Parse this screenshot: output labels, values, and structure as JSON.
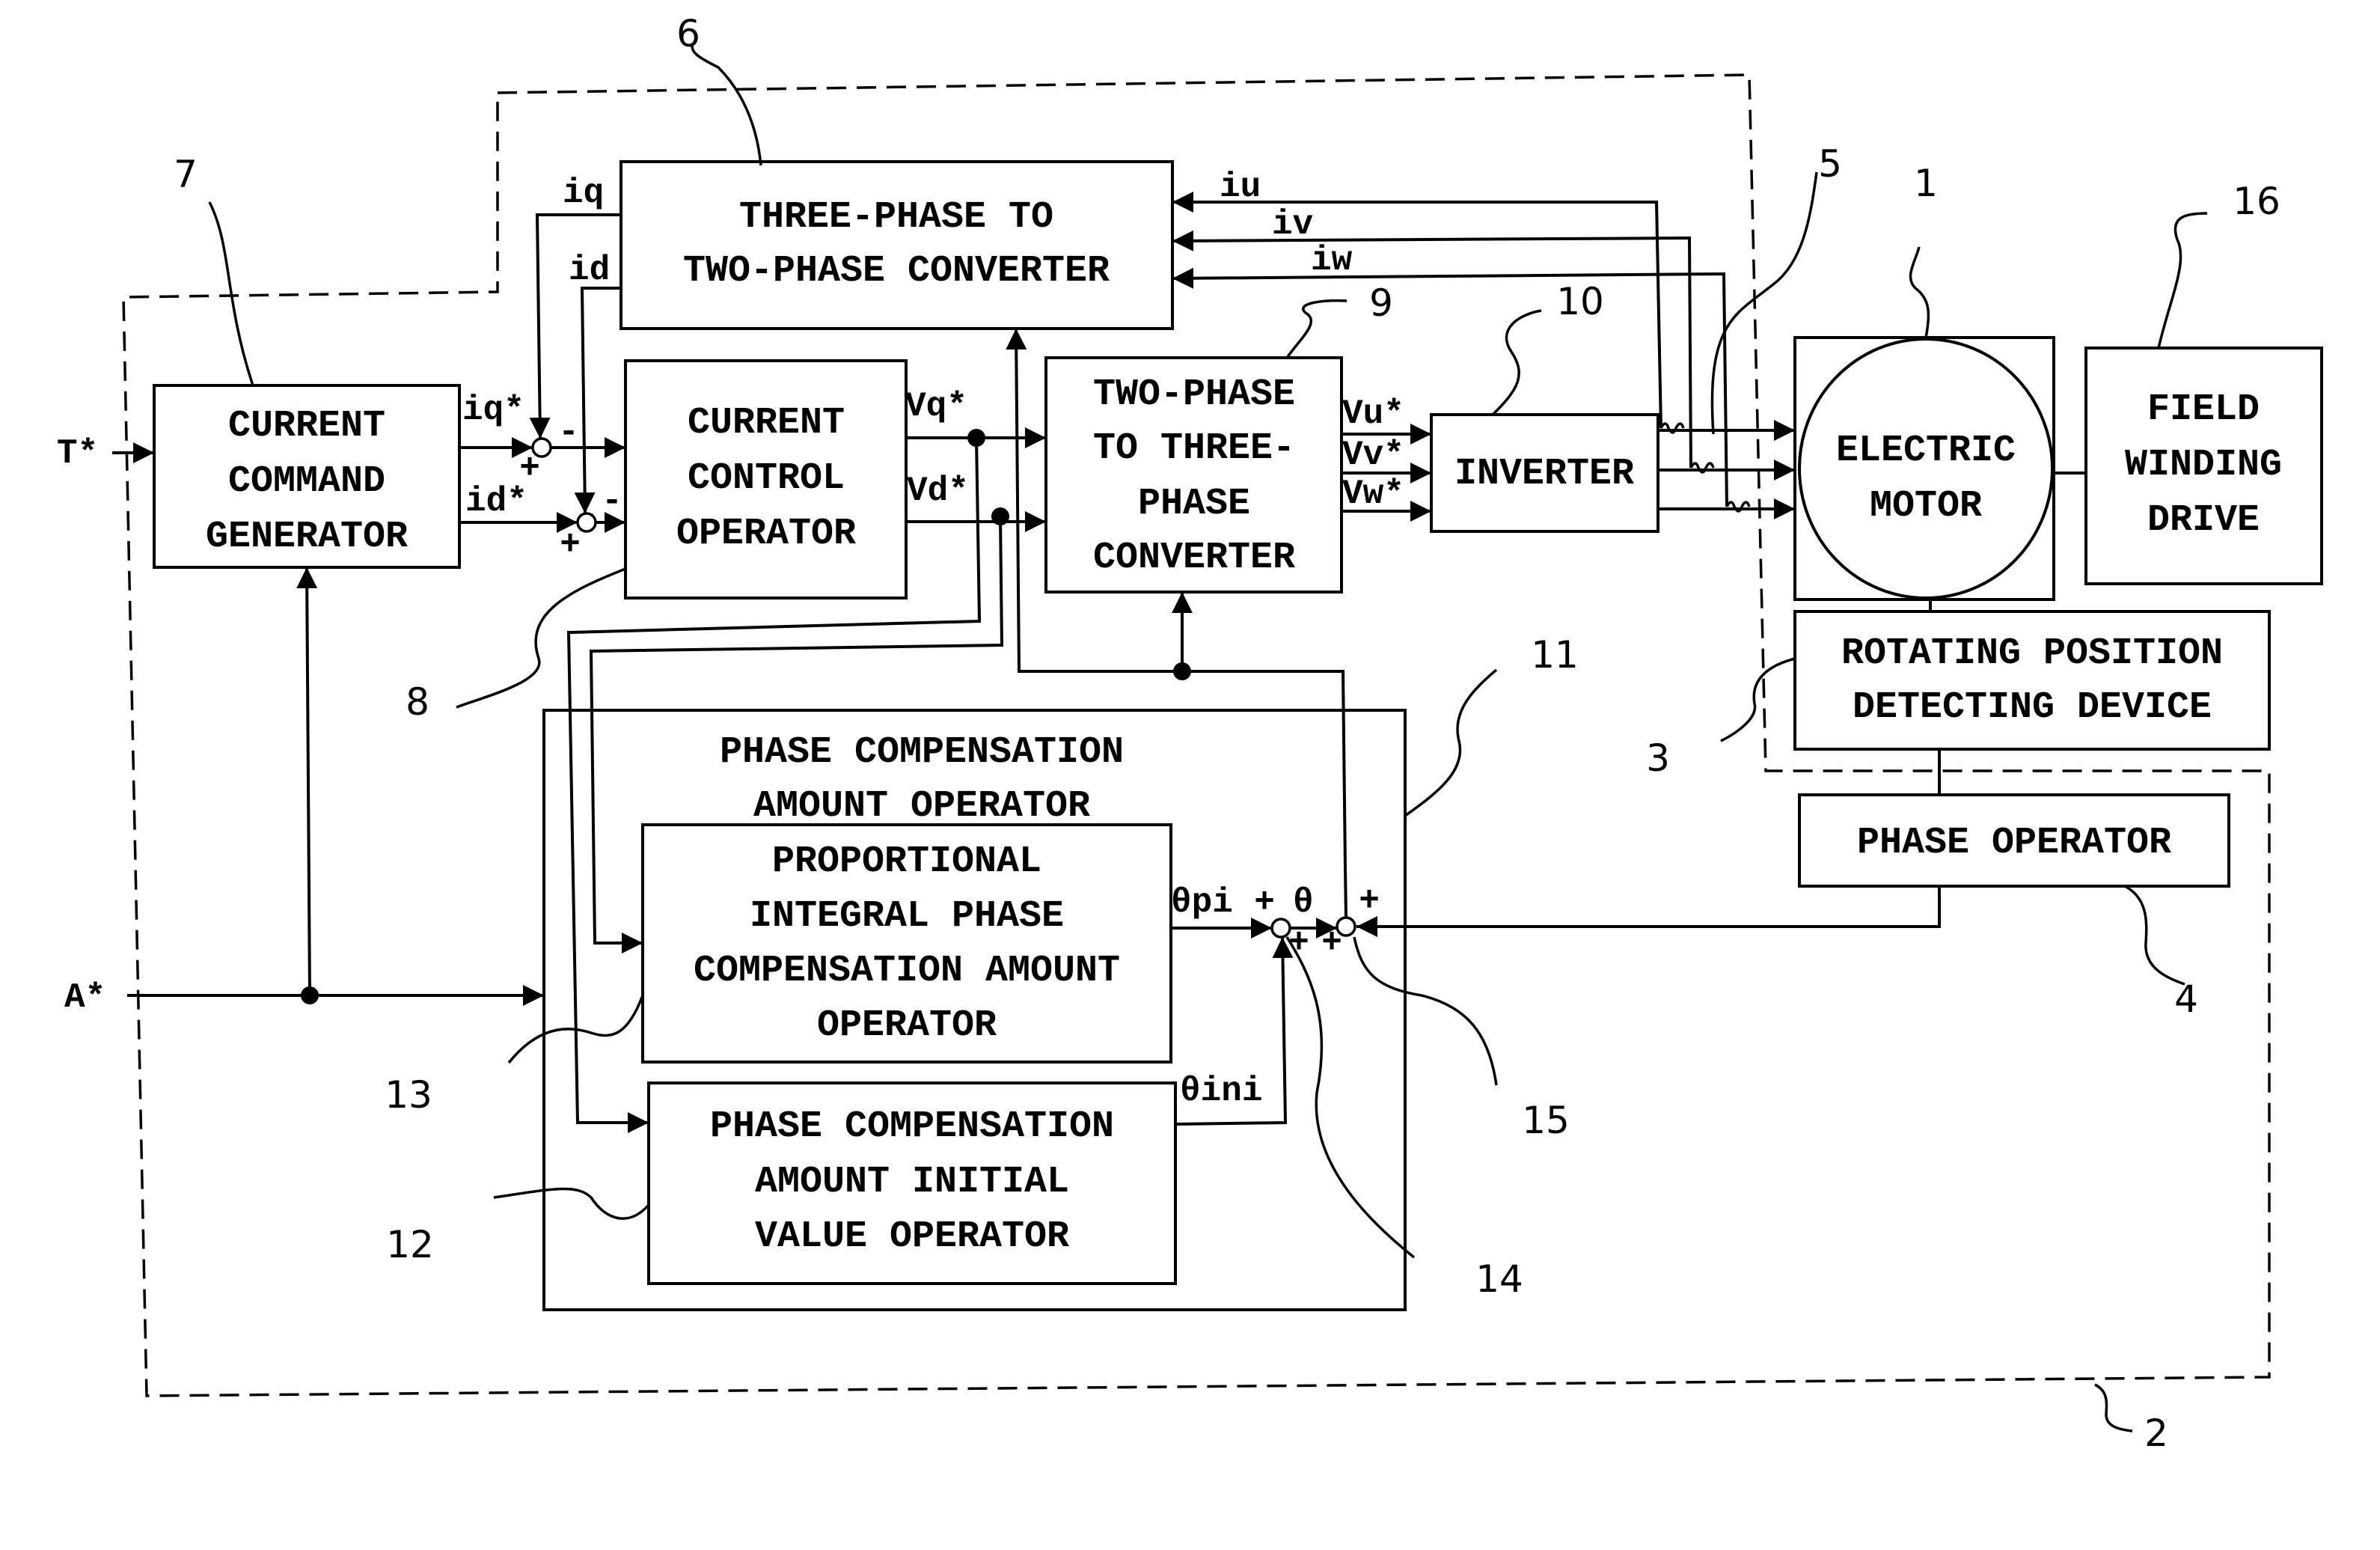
{
  "diagram": {
    "type": "block-diagram",
    "title": "Electric motor control device (patent figure)"
  },
  "blocks": {
    "current_command_generator": {
      "ref": "7",
      "lines": [
        "CURRENT",
        "COMMAND",
        "GENERATOR"
      ]
    },
    "three_to_two_converter": {
      "ref": "6",
      "lines": [
        "THREE-PHASE TO",
        "TWO-PHASE CONVERTER"
      ]
    },
    "current_control_operator": {
      "ref": "8",
      "lines": [
        "CURRENT",
        "CONTROL",
        "OPERATOR"
      ]
    },
    "two_to_three_converter": {
      "ref": "9",
      "lines": [
        "TWO-PHASE",
        "TO THREE-",
        "PHASE",
        "CONVERTER"
      ]
    },
    "inverter": {
      "ref": "10",
      "lines": [
        "INVERTER"
      ]
    },
    "electric_motor": {
      "ref": "1",
      "lines": [
        "ELECTRIC",
        "MOTOR"
      ]
    },
    "field_winding_drive": {
      "ref": "16",
      "lines": [
        "FIELD",
        "WINDING",
        "DRIVE"
      ]
    },
    "rotating_position_detecting_device": {
      "ref": "3",
      "lines": [
        "ROTATING POSITION",
        "DETECTING DEVICE"
      ]
    },
    "phase_operator": {
      "ref": "4",
      "lines": [
        "PHASE OPERATOR"
      ]
    },
    "phase_compensation_amount_operator": {
      "ref": "11",
      "lines": [
        "PHASE COMPENSATION",
        "AMOUNT OPERATOR"
      ]
    },
    "pi_phase_compensation_operator": {
      "ref": "13",
      "lines": [
        "PROPORTIONAL",
        "INTEGRAL PHASE",
        "COMPENSATION AMOUNT",
        "OPERATOR"
      ]
    },
    "initial_value_operator": {
      "ref": "12",
      "lines": [
        "PHASE COMPENSATION",
        "AMOUNT INITIAL",
        "VALUE OPERATOR"
      ]
    }
  },
  "signals": {
    "t_star": "T*",
    "a_star": "A*",
    "iq_star": "iq*",
    "id_star": "id*",
    "iq": "iq",
    "id": "id",
    "iu": "iu",
    "iv": "iv",
    "iw": "iw",
    "vq_star": "Vq*",
    "vd_star": "Vd*",
    "vu_star": "Vu*",
    "vv_star": "Vv*",
    "vw_star": "Vw*",
    "theta_pi": "θpi",
    "theta": "θ",
    "theta_ini": "θini",
    "plus": "+",
    "minus": "-"
  },
  "reference_numbers": {
    "controller_dashed_boundary": "2",
    "current_sensor": "5",
    "adder_14": "14",
    "adder_15": "15"
  }
}
